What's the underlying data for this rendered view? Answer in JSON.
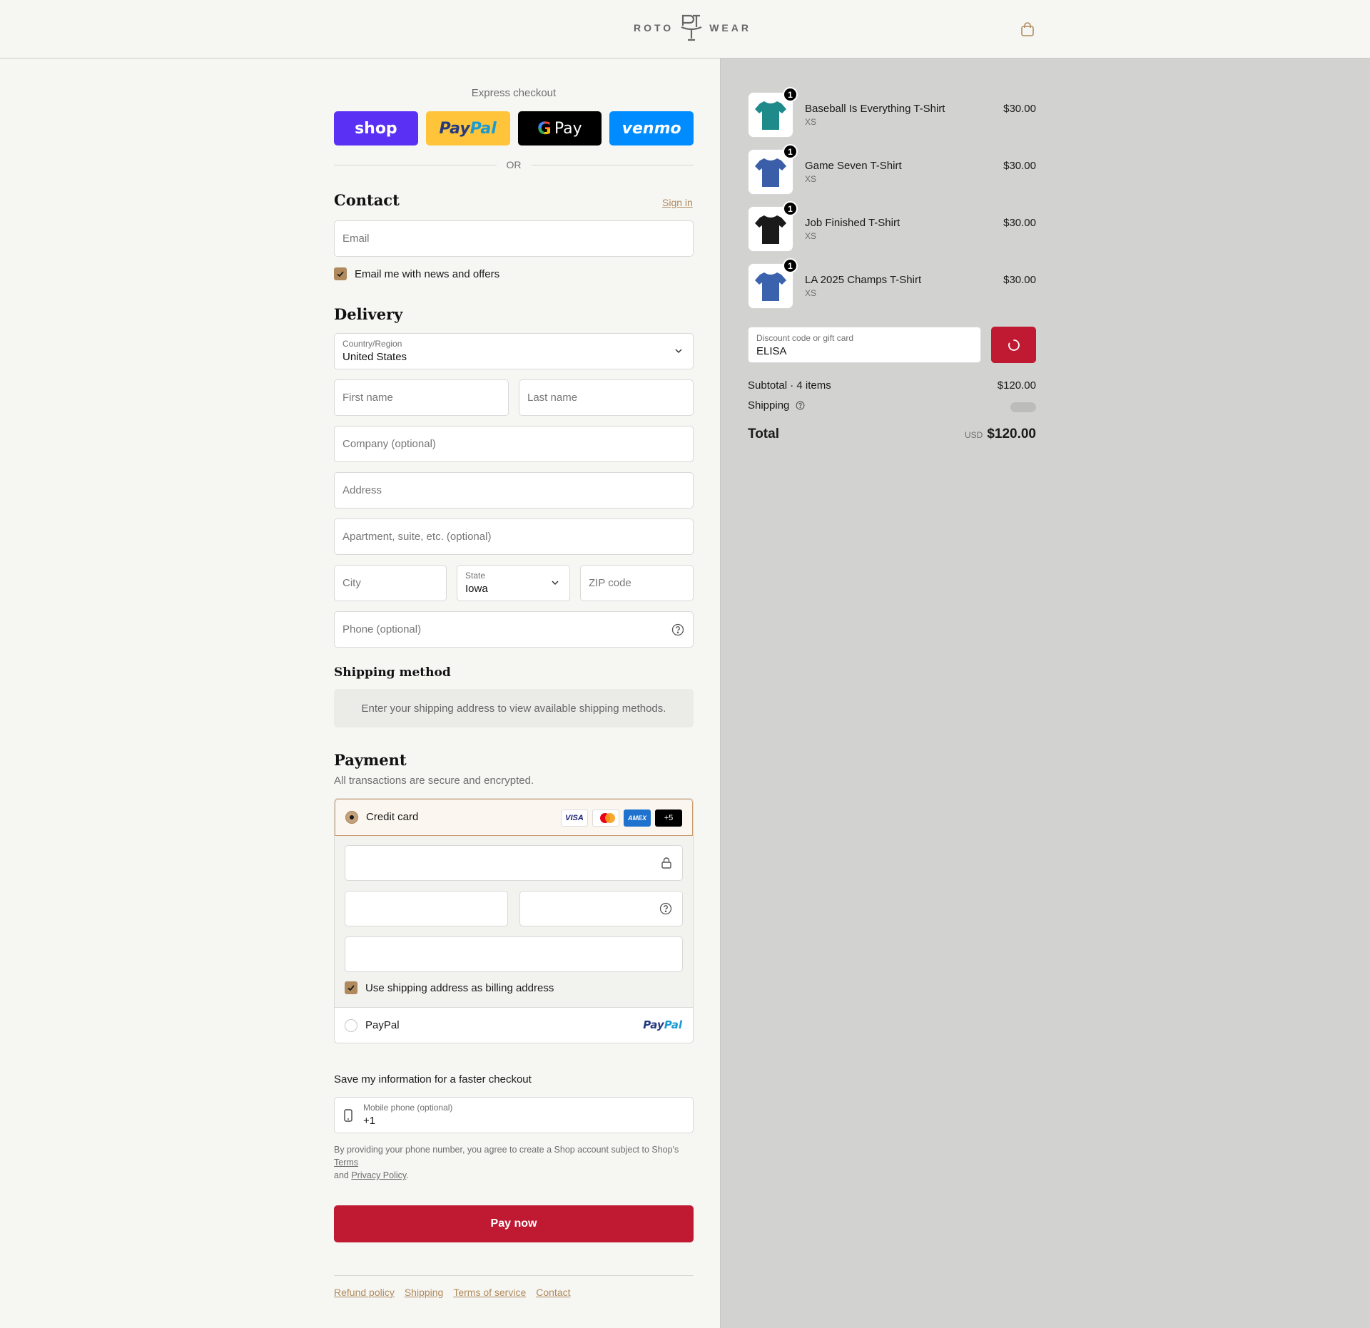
{
  "header": {
    "logo_left": "ROTO",
    "logo_right": "WEAR",
    "cart_icon": "shopping-bag-icon"
  },
  "express": {
    "title": "Express checkout",
    "shop": "shop",
    "paypal_a": "Pay",
    "paypal_b": "Pal",
    "gpay": "Pay",
    "venmo": "venmo",
    "or": "OR"
  },
  "contact": {
    "title": "Contact",
    "sign_in": "Sign in",
    "email_placeholder": "Email",
    "newsletter_label": "Email me with news and offers"
  },
  "delivery": {
    "title": "Delivery",
    "country_label": "Country/Region",
    "country_value": "United States",
    "first_name": "First name",
    "last_name": "Last name",
    "company": "Company (optional)",
    "address": "Address",
    "apartment": "Apartment, suite, etc. (optional)",
    "city": "City",
    "state_label": "State",
    "state_value": "Iowa",
    "zip": "ZIP code",
    "phone": "Phone (optional)"
  },
  "shipping_method": {
    "title": "Shipping method",
    "message": "Enter your shipping address to view available shipping methods."
  },
  "payment": {
    "title": "Payment",
    "subtitle": "All transactions are secure and encrypted.",
    "credit_card_label": "Credit card",
    "card_logos": {
      "visa": "VISA",
      "amex": "AMEX",
      "more": "+5"
    },
    "billing_label": "Use shipping address as billing address",
    "paypal_label": "PayPal",
    "paypal_logo_a": "Pay",
    "paypal_logo_b": "Pal"
  },
  "save_info": {
    "title": "Save my information for a faster checkout",
    "mobile_label": "Mobile phone (optional)",
    "mobile_value": "+1",
    "legal_prefix": "By providing your phone number, you agree to create a Shop account subject to Shop's",
    "terms": "Terms",
    "and": "and",
    "privacy": "Privacy Policy"
  },
  "pay_now": "Pay now",
  "footer": {
    "links": [
      "Refund policy",
      "Shipping",
      "Terms of service",
      "Contact"
    ]
  },
  "summary": {
    "items": [
      {
        "name": "Baseball Is Everything T-Shirt",
        "variant": "XS",
        "price": "$30.00",
        "qty": "1",
        "color": "#1f8a8a"
      },
      {
        "name": "Game Seven T-Shirt",
        "variant": "XS",
        "price": "$30.00",
        "qty": "1",
        "color": "#3a5fa8"
      },
      {
        "name": "Job Finished T-Shirt",
        "variant": "XS",
        "price": "$30.00",
        "qty": "1",
        "color": "#1a1a1a"
      },
      {
        "name": "LA 2025 Champs T-Shirt",
        "variant": "XS",
        "price": "$30.00",
        "qty": "1",
        "color": "#3b62ad"
      }
    ],
    "discount_label": "Discount code or gift card",
    "discount_value": "ELISA",
    "subtotal_label": "Subtotal · 4 items",
    "subtotal_value": "$120.00",
    "shipping_label": "Shipping",
    "total_label": "Total",
    "currency": "USD",
    "total_value": "$120.00"
  },
  "colors": {
    "accent": "#b08a5c",
    "brand_red": "#c01a33",
    "summary_bg": "#d2d2d0"
  }
}
